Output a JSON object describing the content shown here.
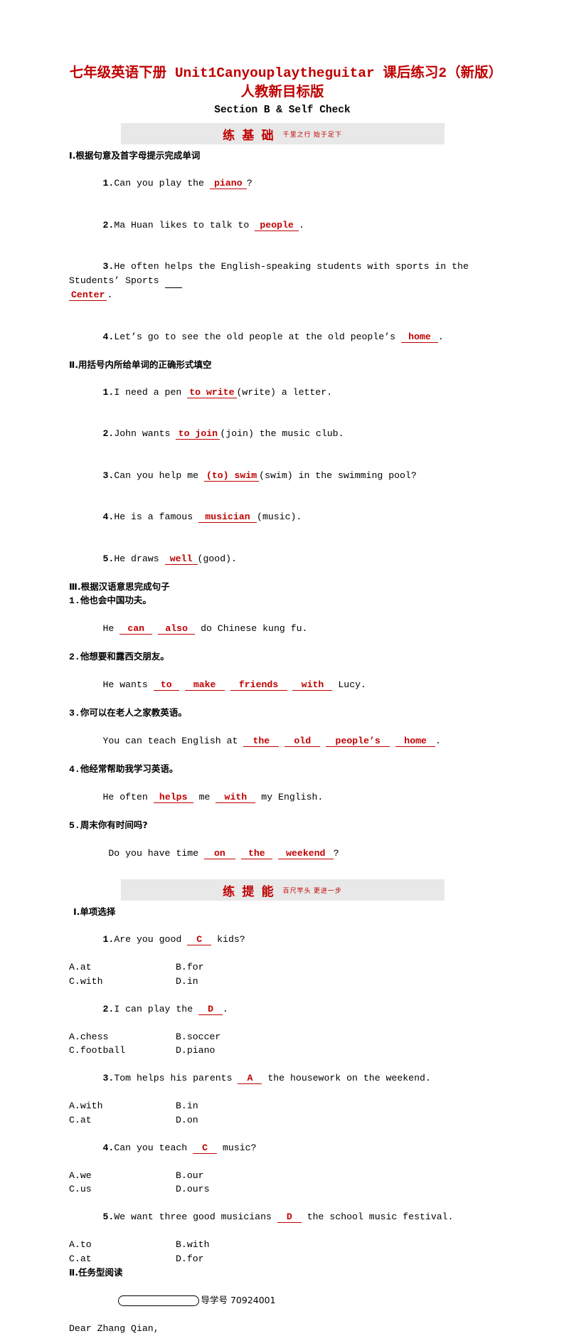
{
  "doc": {
    "title": "七年级英语下册 Unit1Canyouplaytheguitar 课后练习2（新版）人教新目标版",
    "subtitle": "Section B & Self Check"
  },
  "band1": {
    "title": "练 基 础",
    "sub": "千里之行 始于足下"
  },
  "band2": {
    "title": "练 提 能",
    "sub": "百尺竿头 更进一步"
  },
  "section1": {
    "heading": "Ⅰ.根据句意及首字母提示完成单词",
    "items": [
      {
        "num": "1.",
        "pre": "Can you play the ",
        "ans": "piano",
        "post": "?"
      },
      {
        "num": "2.",
        "pre": "Ma Huan likes to talk to ",
        "ans": "people",
        "post": "."
      },
      {
        "num": "3.",
        "pre": "He often helps the English-speaking students with sports in the Students’ Sports ",
        "ans": "Center",
        "post": "."
      },
      {
        "num": "4.",
        "pre": "Let’s go to see the old people at the old people’s ",
        "ans": "home",
        "post": "."
      }
    ]
  },
  "section2": {
    "heading": "Ⅱ.用括号内所给单词的正确形式填空",
    "items": [
      {
        "num": "1.",
        "pre": "I need a pen ",
        "ans": "to write",
        "post": "(write) a letter."
      },
      {
        "num": "2.",
        "pre": "John wants ",
        "ans": "to join",
        "post": "(join) the music club."
      },
      {
        "num": "3.",
        "pre": "Can you help me ",
        "ans": "(to) swim",
        "post": "(swim) in the swimming pool?"
      },
      {
        "num": "4.",
        "pre": "He is a famous ",
        "ans": "musician",
        "post": "(music)."
      },
      {
        "num": "5.",
        "pre": "He draws ",
        "ans": "well",
        "post": "(good)."
      }
    ]
  },
  "section3": {
    "heading": "Ⅲ.根据汉语意思完成句子",
    "items": [
      {
        "num": "1.",
        "cn": "他也会中国功夫。",
        "pre": "He ",
        "ans1": "can",
        "mid": " ",
        "ans2": "also",
        "post": " do Chinese kung fu."
      },
      {
        "num": "2.",
        "cn": "他想要和露西交朋友。",
        "pre": "He wants ",
        "ans1": "to",
        "ans2": "make",
        "ans3": "friends",
        "ans4": "with",
        "post": " Lucy."
      },
      {
        "num": "3.",
        "cn": "你可以在老人之家教英语。",
        "pre": "You can teach English at ",
        "ans1": "the",
        "ans2": "old",
        "ans3": "people’s",
        "ans4": "home",
        "post": "."
      },
      {
        "num": "4.",
        "cn": "他经常帮助我学习英语。",
        "pre": "He often ",
        "ans1": "helps",
        "mid": " me ",
        "ans2": "with",
        "post": " my English."
      },
      {
        "num": "5.",
        "cn": "周末你有时间吗?",
        "pre": " Do you have time ",
        "ans1": "on",
        "ans2": "the",
        "ans3": "weekend",
        "post": "?"
      }
    ]
  },
  "section4": {
    "heading": "Ⅰ.单项选择",
    "items": [
      {
        "num": "1.",
        "pre": "Are you good ",
        "ans": "C",
        "post": " kids?",
        "a": "A.at",
        "b": "B.for",
        "c": "C.with",
        "d": "D.in"
      },
      {
        "num": "2.",
        "pre": "I can play the ",
        "ans": "D",
        "post": ".",
        "a": "A.chess",
        "b": "B.soccer",
        "c": "C.football",
        "d": "D.piano"
      },
      {
        "num": "3.",
        "pre": "Tom helps his parents ",
        "ans": "A",
        "post": " the housework on the weekend.",
        "a": "A.with",
        "b": "B.in",
        "c": "C.at",
        "d": "D.on"
      },
      {
        "num": "4.",
        "pre": "Can you teach ",
        "ans": "C",
        "post": " music?",
        "a": "A.we",
        "b": "B.our",
        "c": "C.us",
        "d": "D.ours"
      },
      {
        "num": "5.",
        "pre": "We want three good musicians ",
        "ans": "D",
        "post": " the school music festival.",
        "a": "A.to",
        "b": "B.with",
        "c": "C.at",
        "d": "D.for"
      }
    ]
  },
  "section5": {
    "heading": "Ⅱ.任务型阅读",
    "code": "导学号 70924001",
    "greeting": "Dear Zhang Qian,"
  }
}
